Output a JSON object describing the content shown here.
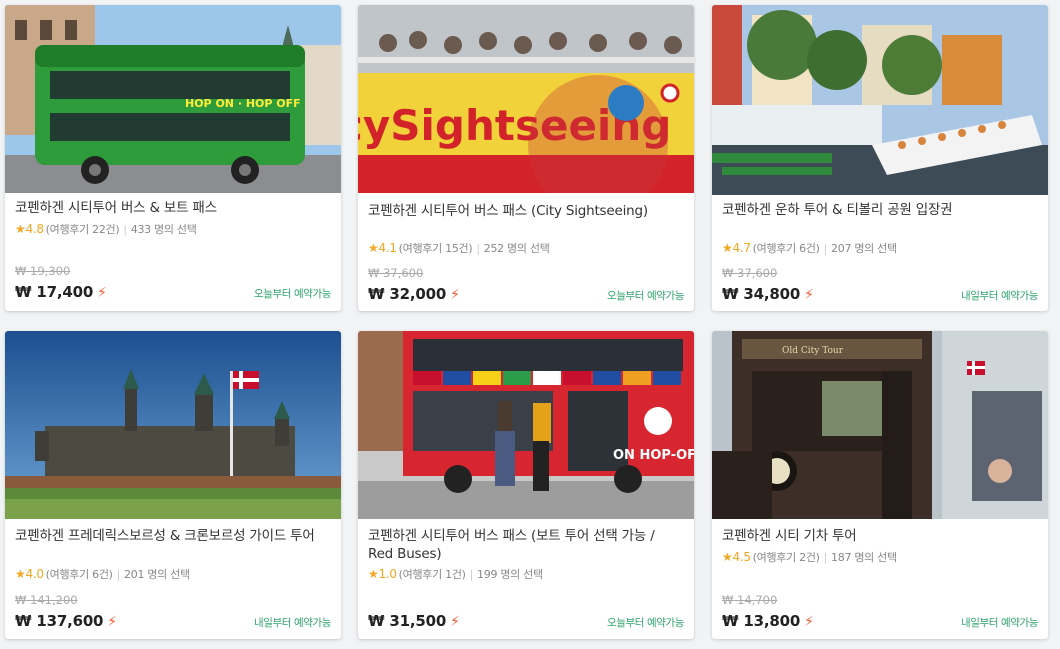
{
  "colors": {
    "availability_text": "#2ea36b",
    "rating_star": "#f5a623",
    "instant_bolt": "#ff5a36"
  },
  "cards": [
    {
      "title": "코펜하겐 시티투어 버스 & 보트 패스",
      "rating": "4.8",
      "reviews": "(여행후기 22건)",
      "selected": "433 명의 선택",
      "original_price": "₩ 19,300",
      "price": "₩ 17,400",
      "availability": "오늘부터 예약가능",
      "image": "green-hop-on-hop-off-bus"
    },
    {
      "title": "코펜하겐 시티투어 버스 패스 (City Sightseeing)",
      "rating": "4.1",
      "reviews": "(여행후기 15건)",
      "selected": "252 명의 선택",
      "original_price": "₩ 37,600",
      "price": "₩ 32,000",
      "availability": "오늘부터 예약가능",
      "image": "city-sightseeing-red-bus"
    },
    {
      "title": "코펜하겐 운하 투어 & 티볼리 공원 입장권",
      "rating": "4.7",
      "reviews": "(여행후기 6건)",
      "selected": "207 명의 선택",
      "original_price": "₩ 37,600",
      "price": "₩ 34,800",
      "availability": "내일부터 예약가능",
      "image": "nyhavn-canal-boats"
    },
    {
      "title": "코펜하겐 프레데릭스보르성 & 크론보르성 가이드 투어",
      "rating": "4.0",
      "reviews": "(여행후기 6건)",
      "selected": "201 명의 선택",
      "original_price": "₩ 141,200",
      "price": "₩ 137,600",
      "availability": "내일부터 예약가능",
      "image": "kronborg-castle"
    },
    {
      "title": "코펜하겐 시티투어 버스 패스 (보트 투어 선택 가능 / Red Buses)",
      "rating": "1.0",
      "reviews": "(여행후기 1건)",
      "selected": "199 명의 선택",
      "original_price": "",
      "price": "₩ 31,500",
      "availability": "오늘부터 예약가능",
      "image": "red-bus-with-flags"
    },
    {
      "title": "코펜하겐 시티 기차 투어",
      "rating": "4.5",
      "reviews": "(여행후기 2건)",
      "selected": "187 명의 선택",
      "original_price": "₩ 14,700",
      "price": "₩ 13,800",
      "availability": "내일부터 예약가능",
      "image": "old-city-tour-train"
    }
  ]
}
